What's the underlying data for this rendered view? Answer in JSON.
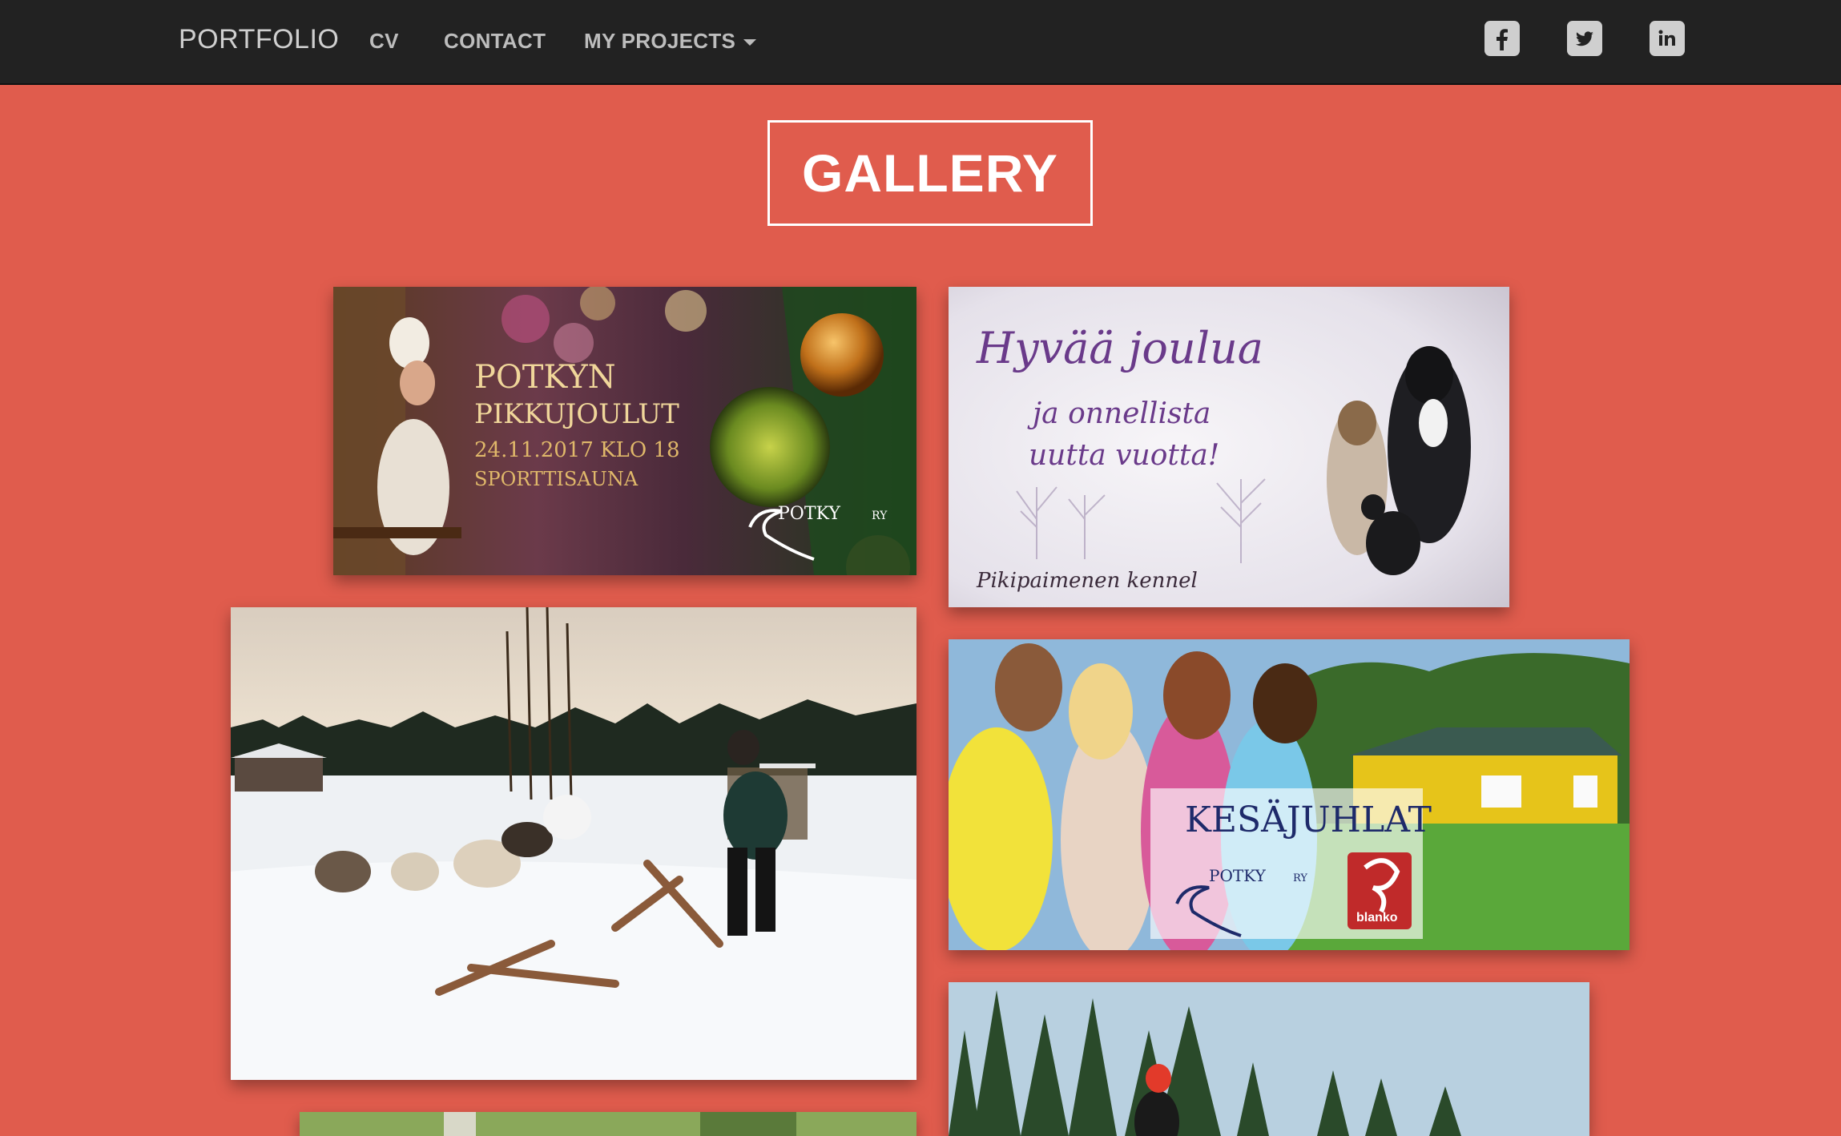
{
  "nav": {
    "brand": "PORTFOLIO",
    "links": [
      "CV",
      "CONTACT",
      "MY PROJECTS"
    ],
    "social_icons": [
      "facebook-icon",
      "twitter-icon",
      "linkedin-icon"
    ]
  },
  "gallery": {
    "title": "GALLERY",
    "tiles": [
      {
        "lines": [
          "POTKYN",
          "PIKKUJOULUT",
          "24.11.2017 KLO 18",
          "SPORTTISAUNA"
        ],
        "logo": "POTKY",
        "logo_suffix": "RY"
      },
      {
        "lines": [
          "Hyvää joulua",
          "ja onnellista",
          "uutta vuotta!"
        ],
        "footer": "Pikipaimenen kennel"
      },
      {
        "lines": []
      },
      {
        "lines": [
          "KESÄJUHLAT"
        ],
        "logo": "POTKY",
        "logo_suffix": "RY",
        "badge": "blanko"
      },
      {
        "lines": []
      },
      {
        "lines": []
      }
    ]
  },
  "colors": {
    "background": "#e05c4d",
    "navbar": "#222222",
    "nav_text": "#bdbdbd"
  }
}
